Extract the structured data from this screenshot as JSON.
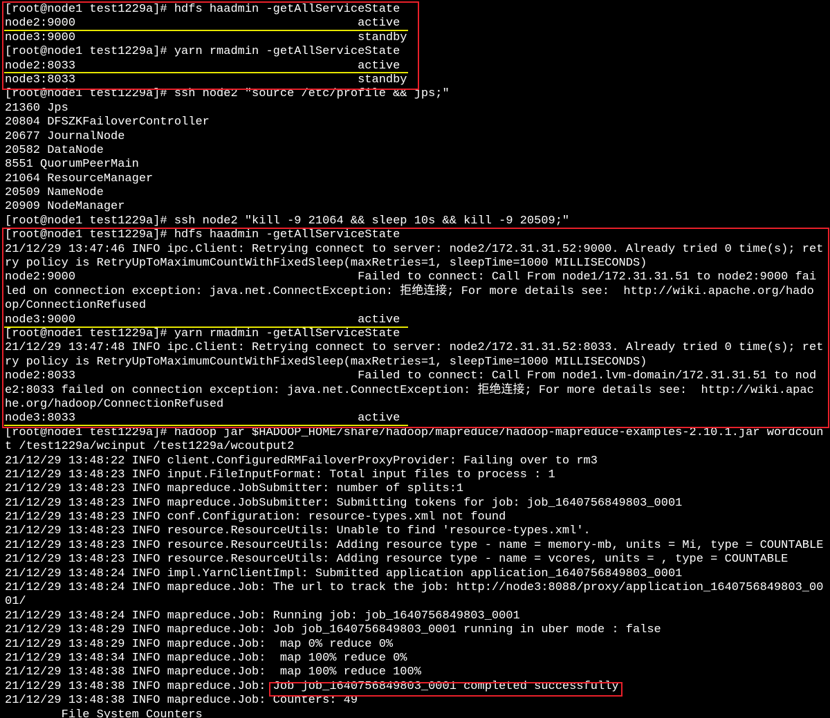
{
  "terminal": {
    "lines": [
      "[root@node1 test1229a]# hdfs haadmin -getAllServiceState",
      "node2:9000                                        active",
      "node3:9000                                        standby",
      "[root@node1 test1229a]# yarn rmadmin -getAllServiceState",
      "node2:8033                                        active",
      "node3:8033                                        standby",
      "[root@node1 test1229a]# ssh node2 \"source /etc/profile && jps;\"",
      "21360 Jps",
      "20804 DFSZKFailoverController",
      "20677 JournalNode",
      "20582 DataNode",
      "8551 QuorumPeerMain",
      "21064 ResourceManager",
      "20509 NameNode",
      "20909 NodeManager",
      "[root@node1 test1229a]# ssh node2 \"kill -9 21064 && sleep 10s && kill -9 20509;\"",
      "[root@node1 test1229a]# hdfs haadmin -getAllServiceState",
      "21/12/29 13:47:46 INFO ipc.Client: Retrying connect to server: node2/172.31.31.52:9000. Already tried 0 time(s); ret",
      "ry policy is RetryUpToMaximumCountWithFixedSleep(maxRetries=1, sleepTime=1000 MILLISECONDS)",
      "node2:9000                                        Failed to connect: Call From node1/172.31.31.51 to node2:9000 fai",
      "led on connection exception: java.net.ConnectException: 拒绝连接; For more details see:  http://wiki.apache.org/hado",
      "op/ConnectionRefused",
      "node3:9000                                        active",
      "[root@node1 test1229a]# yarn rmadmin -getAllServiceState",
      "21/12/29 13:47:48 INFO ipc.Client: Retrying connect to server: node2/172.31.31.52:8033. Already tried 0 time(s); ret",
      "ry policy is RetryUpToMaximumCountWithFixedSleep(maxRetries=1, sleepTime=1000 MILLISECONDS)",
      "node2:8033                                        Failed to connect: Call From node1.lvm-domain/172.31.31.51 to nod",
      "e2:8033 failed on connection exception: java.net.ConnectException: 拒绝连接; For more details see:  http://wiki.apac",
      "he.org/hadoop/ConnectionRefused",
      "node3:8033                                        active",
      "[root@node1 test1229a]# hadoop jar $HADOOP_HOME/share/hadoop/mapreduce/hadoop-mapreduce-examples-2.10.1.jar wordcoun",
      "t /test1229a/wcinput /test1229a/wcoutput2",
      "21/12/29 13:48:22 INFO client.ConfiguredRMFailoverProxyProvider: Failing over to rm3",
      "21/12/29 13:48:23 INFO input.FileInputFormat: Total input files to process : 1",
      "21/12/29 13:48:23 INFO mapreduce.JobSubmitter: number of splits:1",
      "21/12/29 13:48:23 INFO mapreduce.JobSubmitter: Submitting tokens for job: job_1640756849803_0001",
      "21/12/29 13:48:23 INFO conf.Configuration: resource-types.xml not found",
      "21/12/29 13:48:23 INFO resource.ResourceUtils: Unable to find 'resource-types.xml'.",
      "21/12/29 13:48:23 INFO resource.ResourceUtils: Adding resource type - name = memory-mb, units = Mi, type = COUNTABLE",
      "21/12/29 13:48:23 INFO resource.ResourceUtils: Adding resource type - name = vcores, units = , type = COUNTABLE",
      "21/12/29 13:48:24 INFO impl.YarnClientImpl: Submitted application application_1640756849803_0001",
      "21/12/29 13:48:24 INFO mapreduce.Job: The url to track the job: http://node3:8088/proxy/application_1640756849803_00",
      "01/",
      "21/12/29 13:48:24 INFO mapreduce.Job: Running job: job_1640756849803_0001",
      "21/12/29 13:48:29 INFO mapreduce.Job: Job job_1640756849803_0001 running in uber mode : false",
      "21/12/29 13:48:29 INFO mapreduce.Job:  map 0% reduce 0%",
      "21/12/29 13:48:34 INFO mapreduce.Job:  map 100% reduce 0%",
      "21/12/29 13:48:38 INFO mapreduce.Job:  map 100% reduce 100%",
      "21/12/29 13:48:38 INFO mapreduce.Job: Job job_1640756849803_0001 completed successfully",
      "21/12/29 13:48:38 INFO mapreduce.Job: Counters: 49",
      "        File System Counters"
    ]
  },
  "colors": {
    "background": "#000000",
    "text": "#ffffff",
    "highlight_box": "#e8202a",
    "underline": "#e6e600"
  }
}
